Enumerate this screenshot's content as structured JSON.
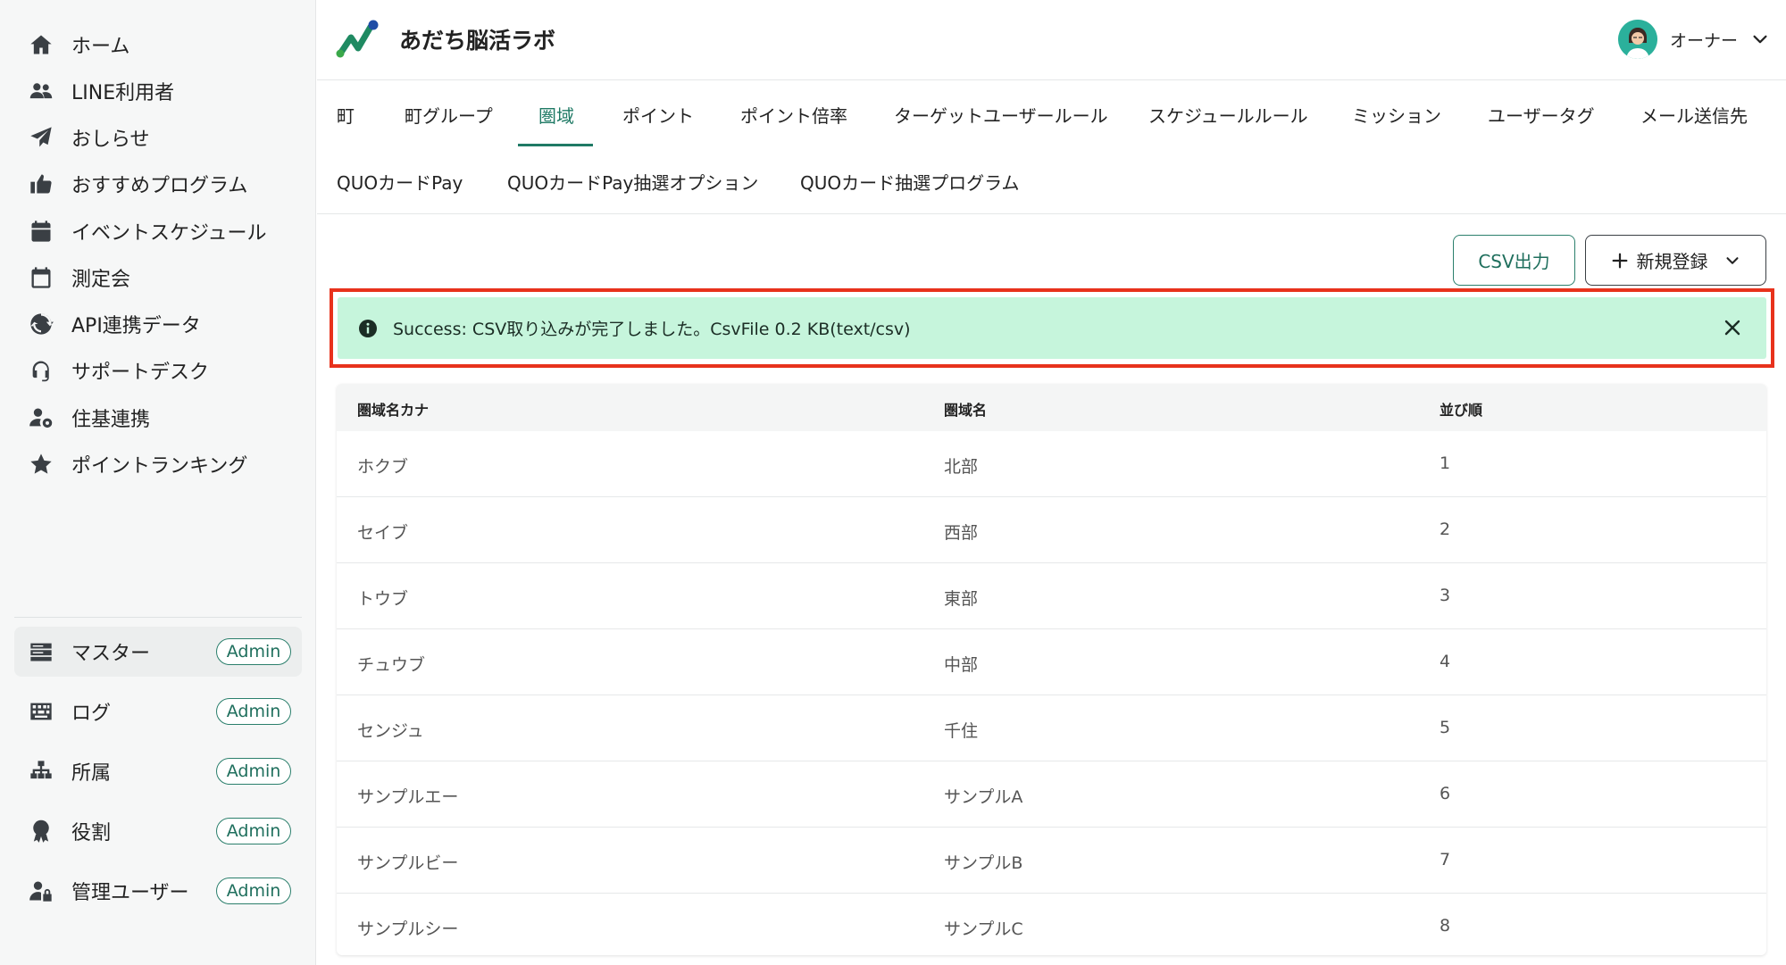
{
  "app": {
    "title": "あだち脳活ラボ"
  },
  "user": {
    "name": "オーナー"
  },
  "sidebar": {
    "items": [
      {
        "label": "ホーム",
        "icon": "home-icon"
      },
      {
        "label": "LINE利用者",
        "icon": "users-icon"
      },
      {
        "label": "おしらせ",
        "icon": "paper-plane-icon"
      },
      {
        "label": "おすすめプログラム",
        "icon": "thumbs-up-icon"
      },
      {
        "label": "イベントスケジュール",
        "icon": "calendar-icon"
      },
      {
        "label": "測定会",
        "icon": "calendar-outline-icon"
      },
      {
        "label": "API連携データ",
        "icon": "sync-icon"
      },
      {
        "label": "サポートデスク",
        "icon": "headset-icon"
      },
      {
        "label": "住基連携",
        "icon": "user-gear-icon"
      },
      {
        "label": "ポイントランキング",
        "icon": "star-icon"
      }
    ],
    "admin_items": [
      {
        "label": "マスター",
        "badge": "Admin",
        "icon": "server-icon"
      },
      {
        "label": "ログ",
        "badge": "Admin",
        "icon": "keyboard-icon"
      },
      {
        "label": "所属",
        "badge": "Admin",
        "icon": "sitemap-icon"
      },
      {
        "label": "役割",
        "badge": "Admin",
        "icon": "award-icon"
      },
      {
        "label": "管理ユーザー",
        "badge": "Admin",
        "icon": "user-lock-icon"
      }
    ]
  },
  "tabs": [
    "町",
    "町グループ",
    "圏域",
    "ポイント",
    "ポイント倍率",
    "ターゲットユーザールール",
    "スケジュールルール",
    "ミッション",
    "ユーザータグ",
    "メール送信先",
    "QUOカードPay",
    "QUOカードPay抽選オプション",
    "QUOカード抽選プログラム"
  ],
  "active_tab": "圏域",
  "toolbar": {
    "csv_label": "CSV出力",
    "new_label": "新規登録"
  },
  "alert": {
    "message": "Success: CSV取り込みが完了しました。CsvFile 0.2 KB(text/csv)"
  },
  "table": {
    "headers": [
      "圏域名カナ",
      "圏域名",
      "並び順"
    ],
    "rows": [
      [
        "ホクブ",
        "北部",
        "1"
      ],
      [
        "セイブ",
        "西部",
        "2"
      ],
      [
        "トウブ",
        "東部",
        "3"
      ],
      [
        "チュウブ",
        "中部",
        "4"
      ],
      [
        "センジュ",
        "千住",
        "5"
      ],
      [
        "サンプルエー",
        "サンプルA",
        "6"
      ],
      [
        "サンプルビー",
        "サンプルB",
        "7"
      ],
      [
        "サンプルシー",
        "サンプルC",
        "8"
      ]
    ]
  },
  "colors": {
    "accent": "#1f7a65",
    "alert_bg": "#c6f5dc",
    "highlight": "#e8321c"
  }
}
